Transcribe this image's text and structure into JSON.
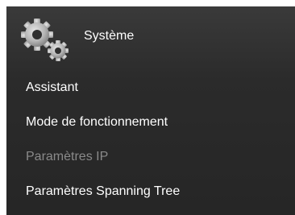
{
  "header": {
    "title": "Système",
    "icon": "gears-icon"
  },
  "menu": {
    "items": [
      {
        "label": "Assistant",
        "state": "normal"
      },
      {
        "label": "Mode de fonctionnement",
        "state": "normal"
      },
      {
        "label": "Paramètres IP",
        "state": "disabled"
      },
      {
        "label": "Paramètres Spanning Tree",
        "state": "normal"
      }
    ]
  },
  "colors": {
    "background": "#2b2b2b",
    "text": "#ffffff",
    "disabled_text": "#8a8a8a",
    "icon": "#bdbdbd"
  }
}
